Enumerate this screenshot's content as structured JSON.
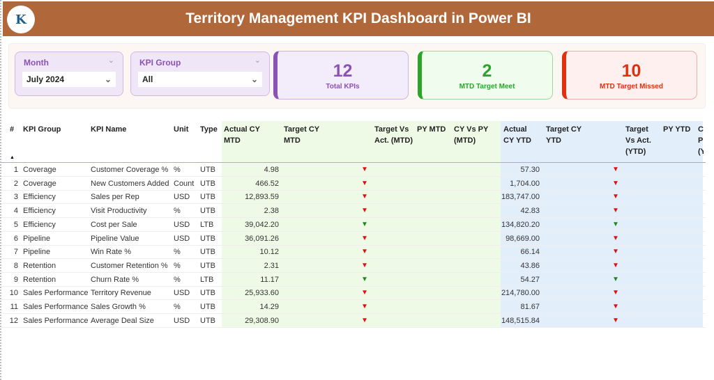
{
  "header": {
    "title": "Territory Management KPI Dashboard in Power BI",
    "logo_text": "K"
  },
  "filters": {
    "month": {
      "label": "Month",
      "value": "July 2024"
    },
    "kpi_group": {
      "label": "KPI Group",
      "value": "All"
    }
  },
  "cards": [
    {
      "value": "12",
      "label": "Total KPIs",
      "color": "#8a52b3"
    },
    {
      "value": "2",
      "label": "MTD Target Meet",
      "color": "#2aa52a"
    },
    {
      "value": "10",
      "label": "MTD Target Missed",
      "color": "#e03010"
    }
  ],
  "table": {
    "headers": [
      "#",
      "KPI Group",
      "KPI Name",
      "Unit",
      "Type",
      "Actual CY MTD",
      "Target CY MTD",
      "Target Vs Act. (MTD)",
      "PY MTD",
      "CY Vs PY (MTD)",
      "Actual CY YTD",
      "Target CY YTD",
      "Target Vs Act. (YTD)",
      "PY YTD",
      "C P (Y"
    ],
    "rows": [
      {
        "n": "1",
        "group": "Coverage",
        "name": "Customer Coverage %",
        "unit": "%",
        "type": "UTB",
        "mtd": "4.98",
        "ytd": "57.30",
        "mtd_status": "down-red",
        "ytd_status": "down-red"
      },
      {
        "n": "2",
        "group": "Coverage",
        "name": "New Customers Added",
        "unit": "Count",
        "type": "UTB",
        "mtd": "466.52",
        "ytd": "1,704.00",
        "mtd_status": "down-red",
        "ytd_status": "down-red"
      },
      {
        "n": "3",
        "group": "Efficiency",
        "name": "Sales per Rep",
        "unit": "USD",
        "type": "UTB",
        "mtd": "12,893.59",
        "ytd": "183,747.00",
        "mtd_status": "down-red",
        "ytd_status": "down-red"
      },
      {
        "n": "4",
        "group": "Efficiency",
        "name": "Visit Productivity",
        "unit": "%",
        "type": "UTB",
        "mtd": "2.38",
        "ytd": "42.83",
        "mtd_status": "down-red",
        "ytd_status": "down-red"
      },
      {
        "n": "5",
        "group": "Efficiency",
        "name": "Cost per Sale",
        "unit": "USD",
        "type": "LTB",
        "mtd": "39,042.20",
        "ytd": "134,820.20",
        "mtd_status": "down-green",
        "ytd_status": "down-green"
      },
      {
        "n": "6",
        "group": "Pipeline",
        "name": "Pipeline Value",
        "unit": "USD",
        "type": "UTB",
        "mtd": "36,091.26",
        "ytd": "98,669.00",
        "mtd_status": "down-red",
        "ytd_status": "down-red"
      },
      {
        "n": "7",
        "group": "Pipeline",
        "name": "Win Rate %",
        "unit": "%",
        "type": "UTB",
        "mtd": "10.12",
        "ytd": "66.14",
        "mtd_status": "down-red",
        "ytd_status": "down-red"
      },
      {
        "n": "8",
        "group": "Retention",
        "name": "Customer Retention %",
        "unit": "%",
        "type": "UTB",
        "mtd": "2.31",
        "ytd": "43.86",
        "mtd_status": "down-red",
        "ytd_status": "down-red"
      },
      {
        "n": "9",
        "group": "Retention",
        "name": "Churn Rate %",
        "unit": "%",
        "type": "LTB",
        "mtd": "11.17",
        "ytd": "54.27",
        "mtd_status": "down-green",
        "ytd_status": "down-green"
      },
      {
        "n": "10",
        "group": "Sales Performance",
        "name": "Territory Revenue",
        "unit": "USD",
        "type": "UTB",
        "mtd": "25,933.60",
        "ytd": "214,780.00",
        "mtd_status": "down-red",
        "ytd_status": "down-red"
      },
      {
        "n": "11",
        "group": "Sales Performance",
        "name": "Sales Growth %",
        "unit": "%",
        "type": "UTB",
        "mtd": "14.29",
        "ytd": "81.67",
        "mtd_status": "down-red",
        "ytd_status": "down-red"
      },
      {
        "n": "12",
        "group": "Sales Performance",
        "name": "Average Deal Size",
        "unit": "USD",
        "type": "UTB",
        "mtd": "29,308.90",
        "ytd": "148,515.84",
        "mtd_status": "down-red",
        "ytd_status": "down-red"
      }
    ]
  },
  "colors": {
    "header": "#b0673a",
    "red": "#e01010",
    "green": "#1e8a1e"
  }
}
